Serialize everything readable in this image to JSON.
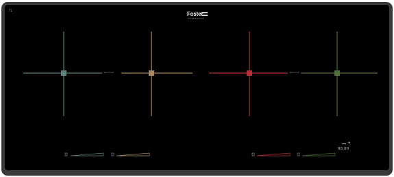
{
  "device": {
    "corner_mark": "TL",
    "brand": "Foster",
    "brand_sub": "FOSTERGAS",
    "colors": {
      "frame": "#3a3a3c",
      "glass": "#000000",
      "zone1": "#5f7f7b",
      "zone2": "#a88b62",
      "zone3": "#b23035",
      "zone4": "#4f6f3c"
    }
  },
  "zones": [
    {
      "name": "zone-1",
      "color": "#5f7f7b"
    },
    {
      "name": "zone-2",
      "color": "#a88b62"
    },
    {
      "name": "zone-3",
      "color": "#b23035"
    },
    {
      "name": "zone-4",
      "color": "#4f6f3c"
    }
  ],
  "bridges": [
    {
      "label": "BRIDGE"
    },
    {
      "label": "BRIDGE"
    }
  ],
  "controls": [
    {
      "icon": "power-level-icon",
      "color": "#5f7f7b"
    },
    {
      "icon": "power-level-icon",
      "color": "#a88b62"
    },
    {
      "icon": "power-level-icon",
      "color": "#b23035"
    },
    {
      "icon": "power-level-icon",
      "color": "#4f6f3c"
    }
  ],
  "timer": {
    "digits": "00:00",
    "icon": "timer-icon"
  }
}
